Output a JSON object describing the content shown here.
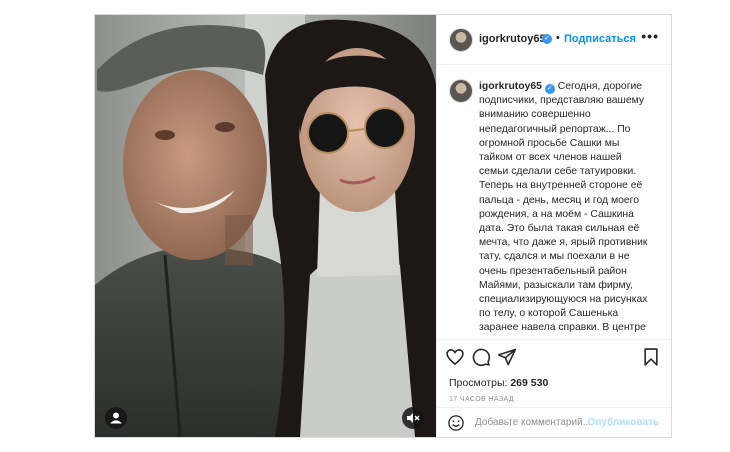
{
  "post": {
    "username": "igorkrutoy65",
    "follow_label": "Подписаться",
    "separator": "•",
    "more_label": "•••",
    "caption_text": " Сегодня, дорогие подписчики, представляю вашему вниманию совершенно непедагогичный репортаж... По огромной просьбе Сашки мы тайком от всех членов нашей семьи сделали себе татуировки. Теперь на внутренней стороне её пальца - день, месяц и год моего рождения, а на моём - Сашкина дата. Это была такая сильная её мечта, что даже я, ярый противник тату, сдался и мы поехали в не очень презентабельный район Майями, разыскали там фирму, специализирующуюся на рисунках по телу, о которой Сашенька заранее навела справки. В центре зала, в котором нам предстояло делать тату, стоял старый",
    "views_label": "Просмотры:",
    "views_count": "269 530",
    "time_ago": "17 ЧАСОВ НАЗАД",
    "comment_placeholder": "Добавьте комментарий...",
    "publish_label": "Опубликовать"
  },
  "icons": {
    "verified": "verified-badge-icon",
    "like": "heart-icon",
    "comment": "comment-bubble-icon",
    "share": "paper-plane-icon",
    "save": "bookmark-icon",
    "emoji": "smiley-icon",
    "tag": "user-tag-icon",
    "mute": "speaker-muted-icon"
  },
  "colors": {
    "accent": "#0095f6",
    "verified": "#3897f0",
    "text": "#262626",
    "secondary": "#8e8e8e",
    "border": "#dbdbdb",
    "publish_disabled": "#b2dffc"
  }
}
